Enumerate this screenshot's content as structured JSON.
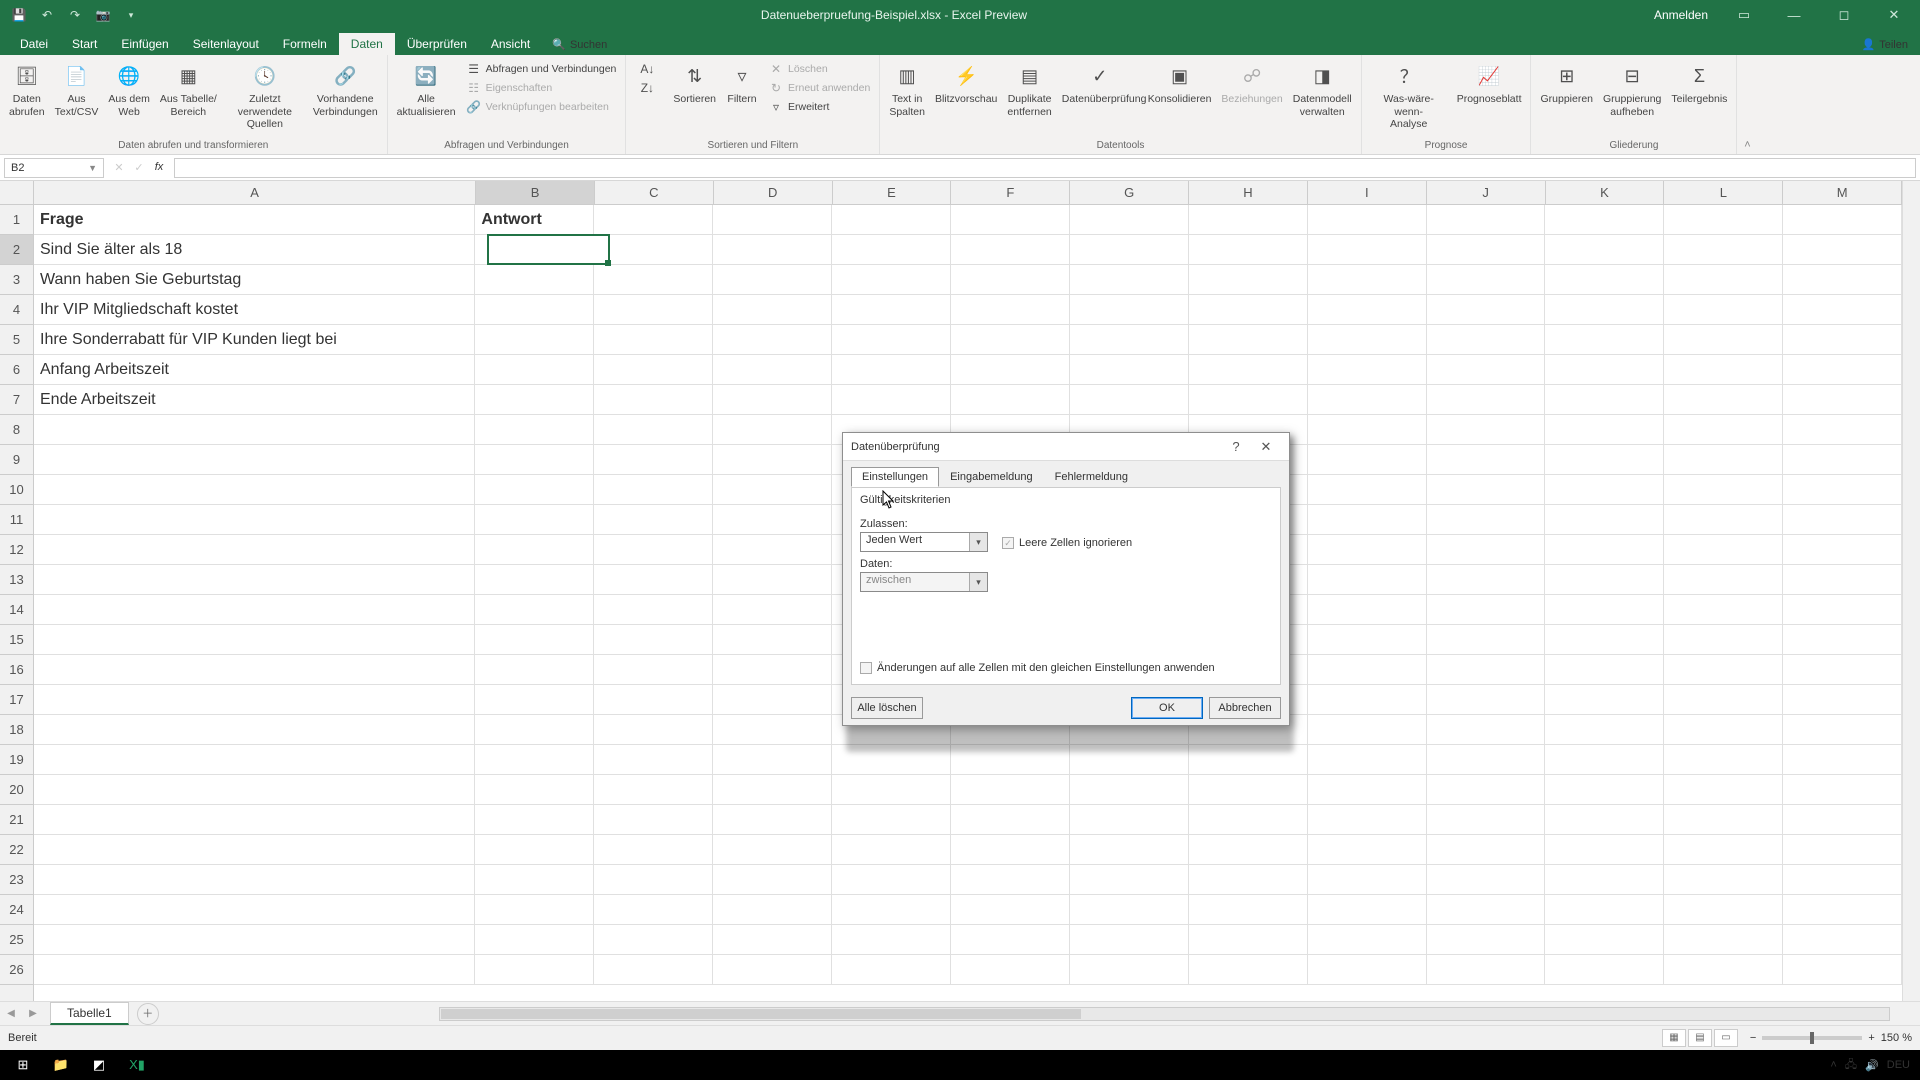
{
  "title": "Datenueberpruefung-Beispiel.xlsx - Excel Preview",
  "login": "Anmelden",
  "tabs": {
    "file": "Datei",
    "home": "Start",
    "insert": "Einfügen",
    "layout": "Seitenlayout",
    "formulas": "Formeln",
    "data": "Daten",
    "review": "Überprüfen",
    "view": "Ansicht",
    "search": "Suchen",
    "share": "Teilen"
  },
  "ribbon": {
    "get": {
      "label": "Daten abrufen und transformieren",
      "b1": "Daten\nabrufen",
      "b2": "Aus\nText/CSV",
      "b3": "Aus dem\nWeb",
      "b4": "Aus Tabelle/\nBereich",
      "b5": "Zuletzt verwendete\nQuellen",
      "b6": "Vorhandene\nVerbindungen"
    },
    "conn": {
      "label": "Abfragen und Verbindungen",
      "b1": "Alle\naktualisieren",
      "s1": "Abfragen und Verbindungen",
      "s2": "Eigenschaften",
      "s3": "Verknüpfungen bearbeiten"
    },
    "sort": {
      "label": "Sortieren und Filtern",
      "b1": "Sortieren",
      "b2": "Filtern",
      "s1": "Löschen",
      "s2": "Erneut anwenden",
      "s3": "Erweitert"
    },
    "tools": {
      "label": "Datentools",
      "b1": "Text in\nSpalten",
      "b2": "Blitzvorschau",
      "b3": "Duplikate\nentfernen",
      "b4": "Datenüberprüfung",
      "b5": "Konsolidieren",
      "b6": "Beziehungen",
      "b7": "Datenmodell\nverwalten"
    },
    "fore": {
      "label": "Prognose",
      "b1": "Was-wäre-wenn-\nAnalyse",
      "b2": "Prognoseblatt"
    },
    "out": {
      "label": "Gliederung",
      "b1": "Gruppieren",
      "b2": "Gruppierung\naufheben",
      "b3": "Teilergebnis"
    }
  },
  "namebox": "B2",
  "columns": [
    "A",
    "B",
    "C",
    "D",
    "E",
    "F",
    "G",
    "H",
    "I",
    "J",
    "K",
    "L",
    "M"
  ],
  "rowcount": 26,
  "selcol_index": 1,
  "selrow_index": 1,
  "cells": {
    "A1": "Frage",
    "B1": "Antwort",
    "A2": "Sind Sie älter als 18",
    "A3": "Wann haben Sie Geburtstag",
    "A4": "Ihr VIP Mitgliedschaft kostet",
    "A5": "Ihre Sonderrabatt für VIP Kunden liegt bei",
    "A6": "Anfang Arbeitszeit",
    "A7": "Ende Arbeitszeit"
  },
  "sheettab": "Tabelle1",
  "status": "Bereit",
  "zoom": "150 %",
  "dialog": {
    "title": "Datenüberprüfung",
    "tab1": "Einstellungen",
    "tab2": "Eingabemeldung",
    "tab3": "Fehlermeldung",
    "group": "Gültigkeitskriterien",
    "allow_lbl": "Zulassen:",
    "allow_val": "Jeden Wert",
    "ignore": "Leere Zellen ignorieren",
    "data_lbl": "Daten:",
    "data_val": "zwischen",
    "applyall": "Änderungen auf alle Zellen mit den gleichen Einstellungen anwenden",
    "clear": "Alle löschen",
    "ok": "OK",
    "cancel": "Abbrechen"
  }
}
